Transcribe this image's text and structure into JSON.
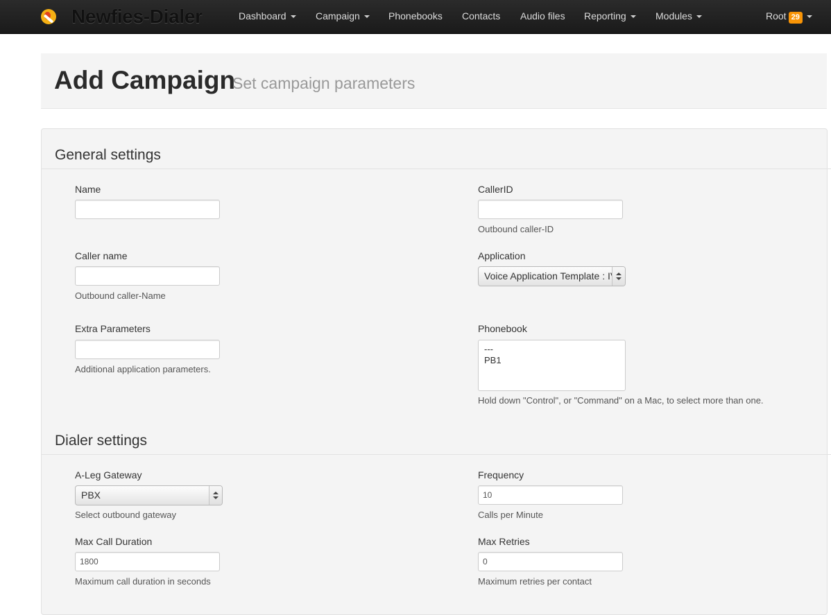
{
  "app": {
    "brand": "Newfies-Dialer"
  },
  "nav": {
    "items": [
      {
        "label": "Dashboard"
      },
      {
        "label": "Campaign"
      },
      {
        "label": "Phonebooks"
      },
      {
        "label": "Contacts"
      },
      {
        "label": "Audio files"
      },
      {
        "label": "Reporting"
      },
      {
        "label": "Modules"
      }
    ],
    "user": {
      "label": "Root",
      "badge": "29"
    }
  },
  "header": {
    "title": "Add Campaign",
    "subtitle": "Set campaign parameters"
  },
  "general": {
    "title": "General settings",
    "name": {
      "label": "Name",
      "value": ""
    },
    "callerid": {
      "label": "CallerID",
      "value": "",
      "help": "Outbound caller-ID"
    },
    "caller_name": {
      "label": "Caller name",
      "value": "",
      "help": "Outbound caller-Name"
    },
    "application": {
      "label": "Application",
      "selected": "Voice Application Template : IVR"
    },
    "extra": {
      "label": "Extra Parameters",
      "value": "",
      "help": "Additional application parameters."
    },
    "phonebook": {
      "label": "Phonebook",
      "options": [
        "---",
        "PB1"
      ],
      "help": "Hold down \"Control\", or \"Command\" on a Mac, to select more than one."
    }
  },
  "dialer": {
    "title": "Dialer settings",
    "aleg": {
      "label": "A-Leg Gateway",
      "selected": "PBX",
      "help": "Select outbound gateway"
    },
    "frequency": {
      "label": "Frequency",
      "value": "10",
      "help": "Calls per Minute"
    },
    "max_duration": {
      "label": "Max Call Duration",
      "value": "1800",
      "help": "Maximum call duration in seconds"
    },
    "max_retries": {
      "label": "Max Retries",
      "value": "0",
      "help": "Maximum retries per contact"
    }
  }
}
